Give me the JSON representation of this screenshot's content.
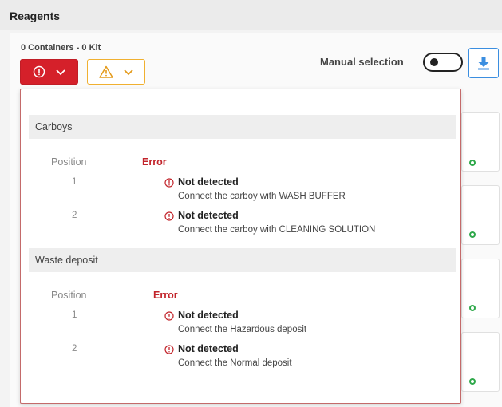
{
  "header": {
    "title": "Reagents"
  },
  "summary": {
    "text": "0 Containers - 0 Kit"
  },
  "toolbar": {
    "manual_selection_label": "Manual selection",
    "manual_selection_on": false
  },
  "colors": {
    "error": "#d5202a",
    "warning": "#f0b030",
    "accent": "#3b8ee0",
    "ok": "#2ea84a"
  },
  "popup": {
    "sections": [
      {
        "title": "Carboys",
        "col_position": "Position",
        "col_error": "Error",
        "rows": [
          {
            "position": "1",
            "title": "Not detected",
            "description": "Connect the carboy with WASH BUFFER"
          },
          {
            "position": "2",
            "title": "Not detected",
            "description": "Connect the carboy with CLEANING SOLUTION"
          }
        ]
      },
      {
        "title": "Waste deposit",
        "col_position": "Position",
        "col_error": "Error",
        "rows": [
          {
            "position": "1",
            "title": "Not detected",
            "description": "Connect the Hazardous deposit"
          },
          {
            "position": "2",
            "title": "Not detected",
            "description": "Connect the Normal deposit"
          }
        ]
      }
    ]
  }
}
